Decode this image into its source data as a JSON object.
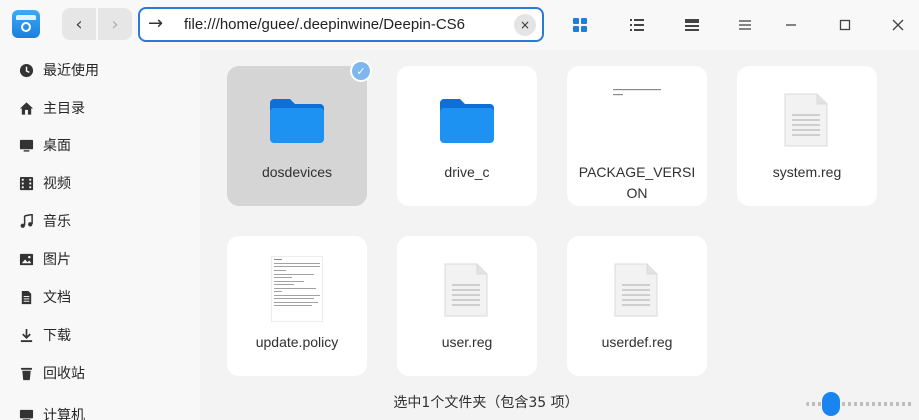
{
  "window": {
    "address": "file:///home/guee/.deepinwine/Deepin-CS6",
    "clear_icon": "×",
    "back_icon": "‹",
    "forward_icon": "›",
    "address_arrow_icon": "→",
    "toolbar_icons": {
      "icon_view": "grid-view-icon",
      "list_view": "list-view-icon",
      "detail_view": "detail-view-icon",
      "menu": "hamburger-menu-icon",
      "minimize": "minimize-icon",
      "maximize": "maximize-icon",
      "close": "close-icon"
    },
    "accent": "#1a7fe0"
  },
  "sidebar": {
    "items": [
      {
        "label": "最近使用",
        "icon": "clock-icon"
      },
      {
        "label": "主目录",
        "icon": "home-icon"
      },
      {
        "label": "桌面",
        "icon": "desktop-icon"
      },
      {
        "label": "视频",
        "icon": "video-icon"
      },
      {
        "label": "音乐",
        "icon": "music-icon"
      },
      {
        "label": "图片",
        "icon": "picture-icon"
      },
      {
        "label": "文档",
        "icon": "document-icon"
      },
      {
        "label": "下载",
        "icon": "download-icon"
      },
      {
        "label": "回收站",
        "icon": "trash-icon"
      },
      {
        "label": "计算机",
        "icon": "computer-icon"
      }
    ]
  },
  "files": [
    {
      "name": "dosdevices",
      "type": "folder",
      "selected": true
    },
    {
      "name": "drive_c",
      "type": "folder",
      "selected": false
    },
    {
      "name_line1": "PACKAGE_VERSI",
      "name_line2": "ON",
      "type": "text-preview",
      "selected": false
    },
    {
      "name": "system.reg",
      "type": "document",
      "selected": false
    },
    {
      "name": "update.policy",
      "type": "text-preview",
      "selected": false
    },
    {
      "name": "user.reg",
      "type": "document",
      "selected": false
    },
    {
      "name": "userdef.reg",
      "type": "document",
      "selected": false
    }
  ],
  "status": {
    "text": "选中1个文件夹（包含35 项）"
  }
}
